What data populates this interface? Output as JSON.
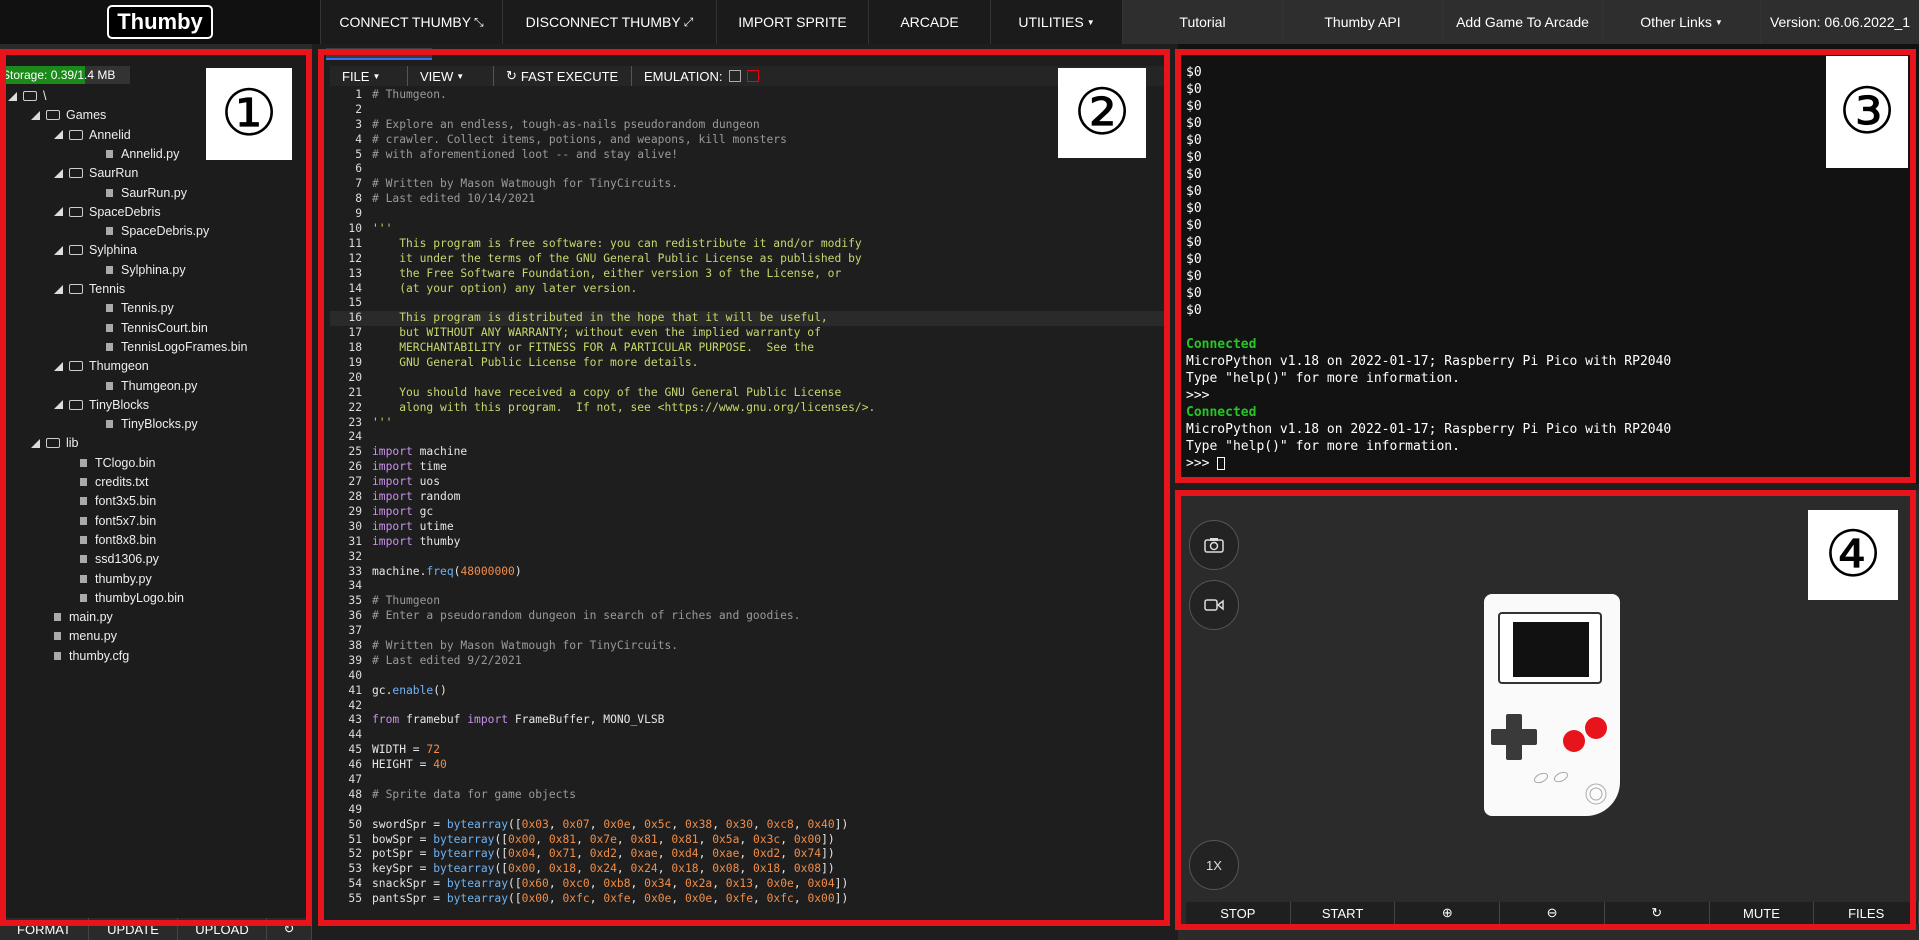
{
  "nav": {
    "logo": "Thumby",
    "buttons": [
      {
        "label": "CONNECT THUMBY",
        "icon": "shrink-arrows-icon"
      },
      {
        "label": "DISCONNECT THUMBY",
        "icon": "expand-arrows-icon"
      },
      {
        "label": "IMPORT SPRITE"
      },
      {
        "label": "ARCADE"
      },
      {
        "label": "UTILITIES"
      },
      {
        "label": "Tutorial"
      },
      {
        "label": "Thumby API"
      },
      {
        "label": "Add Game To Arcade"
      },
      {
        "label": "Other Links"
      },
      {
        "label": "Version: 06.06.2022_1"
      }
    ]
  },
  "filesystem": {
    "storage": "Storage: 0.39/1.4 MB",
    "tree": [
      {
        "label": "\\",
        "type": "folder",
        "depth": 0
      },
      {
        "label": "Games",
        "type": "folder",
        "depth": 1
      },
      {
        "label": "Annelid",
        "type": "folder",
        "depth": 2
      },
      {
        "label": "Annelid.py",
        "type": "file",
        "depth": 3
      },
      {
        "label": "SaurRun",
        "type": "folder",
        "depth": 2
      },
      {
        "label": "SaurRun.py",
        "type": "file",
        "depth": 3
      },
      {
        "label": "SpaceDebris",
        "type": "folder",
        "depth": 2
      },
      {
        "label": "SpaceDebris.py",
        "type": "file",
        "depth": 3
      },
      {
        "label": "Sylphina",
        "type": "folder",
        "depth": 2
      },
      {
        "label": "Sylphina.py",
        "type": "file",
        "depth": 3
      },
      {
        "label": "Tennis",
        "type": "folder",
        "depth": 2
      },
      {
        "label": "Tennis.py",
        "type": "file",
        "depth": 3
      },
      {
        "label": "TennisCourt.bin",
        "type": "file",
        "depth": 3
      },
      {
        "label": "TennisLogoFrames.bin",
        "type": "file",
        "depth": 3
      },
      {
        "label": "Thumgeon",
        "type": "folder",
        "depth": 2
      },
      {
        "label": "Thumgeon.py",
        "type": "file",
        "depth": 3
      },
      {
        "label": "TinyBlocks",
        "type": "folder",
        "depth": 2
      },
      {
        "label": "TinyBlocks.py",
        "type": "file",
        "depth": 3
      },
      {
        "label": "lib",
        "type": "folder",
        "depth": 1
      },
      {
        "label": "TClogo.bin",
        "type": "file",
        "depth": 2
      },
      {
        "label": "credits.txt",
        "type": "file",
        "depth": 2
      },
      {
        "label": "font3x5.bin",
        "type": "file",
        "depth": 2
      },
      {
        "label": "font5x7.bin",
        "type": "file",
        "depth": 2
      },
      {
        "label": "font8x8.bin",
        "type": "file",
        "depth": 2
      },
      {
        "label": "ssd1306.py",
        "type": "file",
        "depth": 2
      },
      {
        "label": "thumby.py",
        "type": "file",
        "depth": 2
      },
      {
        "label": "thumbyLogo.bin",
        "type": "file",
        "depth": 2
      },
      {
        "label": "main.py",
        "type": "file",
        "depth": 1
      },
      {
        "label": "menu.py",
        "type": "file",
        "depth": 1
      },
      {
        "label": "thumby.cfg",
        "type": "file",
        "depth": 1
      }
    ],
    "bottom_buttons": [
      "FORMAT",
      "UPDATE",
      "UPLOAD",
      "↻"
    ]
  },
  "editor": {
    "toolbar": {
      "file": "FILE",
      "view": "VIEW",
      "fast_execute": "FAST EXECUTE",
      "emulation": "EMULATION:"
    },
    "highlight_line": 16,
    "lines": [
      [
        [
          "com",
          "# Thumgeon."
        ]
      ],
      [],
      [
        [
          "com",
          "# Explore an endless, tough-as-nails pseudorandom dungeon"
        ]
      ],
      [
        [
          "com",
          "# crawler. Collect items, potions, and weapons, kill monsters"
        ]
      ],
      [
        [
          "com",
          "# with aforementioned loot -- and stay alive!"
        ]
      ],
      [],
      [
        [
          "com",
          "# Written by Mason Watmough for TinyCircuits."
        ]
      ],
      [
        [
          "com",
          "# Last edited 10/14/2021"
        ]
      ],
      [],
      [
        [
          "str",
          "'''"
        ]
      ],
      [
        [
          "str",
          "    This program is free software: you can redistribute it and/or modify"
        ]
      ],
      [
        [
          "str",
          "    it under the terms of the GNU General Public License as published by"
        ]
      ],
      [
        [
          "str",
          "    the Free Software Foundation, either version 3 of the License, or"
        ]
      ],
      [
        [
          "str",
          "    (at your option) any later version."
        ]
      ],
      [],
      [
        [
          "str",
          "    This program is distributed in the hope that it will be useful,"
        ]
      ],
      [
        [
          "str",
          "    but WITHOUT ANY WARRANTY; without even the implied warranty of"
        ]
      ],
      [
        [
          "str",
          "    MERCHANTABILITY or FITNESS FOR A PARTICULAR PURPOSE.  See the"
        ]
      ],
      [
        [
          "str",
          "    GNU General Public License for more details."
        ]
      ],
      [],
      [
        [
          "str",
          "    You should have received a copy of the GNU General Public License"
        ]
      ],
      [
        [
          "str",
          "    along with this program.  If not, see <https://www.gnu.org/licenses/>."
        ]
      ],
      [
        [
          "str",
          "'''"
        ]
      ],
      [],
      [
        [
          "kw",
          "import"
        ],
        [
          "txt",
          " machine"
        ]
      ],
      [
        [
          "kw",
          "import"
        ],
        [
          "txt",
          " time"
        ]
      ],
      [
        [
          "kw",
          "import"
        ],
        [
          "txt",
          " uos"
        ]
      ],
      [
        [
          "kw",
          "import"
        ],
        [
          "txt",
          " random"
        ]
      ],
      [
        [
          "kw",
          "import"
        ],
        [
          "txt",
          " gc"
        ]
      ],
      [
        [
          "kw",
          "import"
        ],
        [
          "txt",
          " utime"
        ]
      ],
      [
        [
          "kw",
          "import"
        ],
        [
          "txt",
          " thumby"
        ]
      ],
      [],
      [
        [
          "txt",
          "machine."
        ],
        [
          "fn",
          "freq"
        ],
        [
          "txt",
          "("
        ],
        [
          "num",
          "48000000"
        ],
        [
          "txt",
          ")"
        ]
      ],
      [],
      [
        [
          "com",
          "# Thumgeon"
        ]
      ],
      [
        [
          "com",
          "# Enter a pseudorandom dungeon in search of riches and goodies."
        ]
      ],
      [],
      [
        [
          "com",
          "# Written by Mason Watmough for TinyCircuits."
        ]
      ],
      [
        [
          "com",
          "# Last edited 9/2/2021"
        ]
      ],
      [],
      [
        [
          "txt",
          "gc."
        ],
        [
          "fn",
          "enable"
        ],
        [
          "txt",
          "()"
        ]
      ],
      [],
      [
        [
          "kw",
          "from"
        ],
        [
          "txt",
          " framebuf "
        ],
        [
          "kw",
          "import"
        ],
        [
          "txt",
          " FrameBuffer, MONO_VLSB"
        ]
      ],
      [],
      [
        [
          "txt",
          "WIDTH = "
        ],
        [
          "num",
          "72"
        ]
      ],
      [
        [
          "txt",
          "HEIGHT = "
        ],
        [
          "num",
          "40"
        ]
      ],
      [],
      [
        [
          "com",
          "# Sprite data for game objects"
        ]
      ],
      [],
      [
        [
          "txt",
          "swordSpr = "
        ],
        [
          "fn",
          "bytearray"
        ],
        [
          "txt",
          "(["
        ],
        [
          "num",
          "0x03"
        ],
        [
          "txt",
          ", "
        ],
        [
          "num",
          "0x07"
        ],
        [
          "txt",
          ", "
        ],
        [
          "num",
          "0x0e"
        ],
        [
          "txt",
          ", "
        ],
        [
          "num",
          "0x5c"
        ],
        [
          "txt",
          ", "
        ],
        [
          "num",
          "0x38"
        ],
        [
          "txt",
          ", "
        ],
        [
          "num",
          "0x30"
        ],
        [
          "txt",
          ", "
        ],
        [
          "num",
          "0xc8"
        ],
        [
          "txt",
          ", "
        ],
        [
          "num",
          "0x40"
        ],
        [
          "txt",
          "])"
        ]
      ],
      [
        [
          "txt",
          "bowSpr = "
        ],
        [
          "fn",
          "bytearray"
        ],
        [
          "txt",
          "(["
        ],
        [
          "num",
          "0x00"
        ],
        [
          "txt",
          ", "
        ],
        [
          "num",
          "0x81"
        ],
        [
          "txt",
          ", "
        ],
        [
          "num",
          "0x7e"
        ],
        [
          "txt",
          ", "
        ],
        [
          "num",
          "0x81"
        ],
        [
          "txt",
          ", "
        ],
        [
          "num",
          "0x81"
        ],
        [
          "txt",
          ", "
        ],
        [
          "num",
          "0x5a"
        ],
        [
          "txt",
          ", "
        ],
        [
          "num",
          "0x3c"
        ],
        [
          "txt",
          ", "
        ],
        [
          "num",
          "0x00"
        ],
        [
          "txt",
          "])"
        ]
      ],
      [
        [
          "txt",
          "potSpr = "
        ],
        [
          "fn",
          "bytearray"
        ],
        [
          "txt",
          "(["
        ],
        [
          "num",
          "0x04"
        ],
        [
          "txt",
          ", "
        ],
        [
          "num",
          "0x71"
        ],
        [
          "txt",
          ", "
        ],
        [
          "num",
          "0xd2"
        ],
        [
          "txt",
          ", "
        ],
        [
          "num",
          "0xae"
        ],
        [
          "txt",
          ", "
        ],
        [
          "num",
          "0xd4"
        ],
        [
          "txt",
          ", "
        ],
        [
          "num",
          "0xae"
        ],
        [
          "txt",
          ", "
        ],
        [
          "num",
          "0xd2"
        ],
        [
          "txt",
          ", "
        ],
        [
          "num",
          "0x74"
        ],
        [
          "txt",
          "])"
        ]
      ],
      [
        [
          "txt",
          "keySpr = "
        ],
        [
          "fn",
          "bytearray"
        ],
        [
          "txt",
          "(["
        ],
        [
          "num",
          "0x00"
        ],
        [
          "txt",
          ", "
        ],
        [
          "num",
          "0x18"
        ],
        [
          "txt",
          ", "
        ],
        [
          "num",
          "0x24"
        ],
        [
          "txt",
          ", "
        ],
        [
          "num",
          "0x24"
        ],
        [
          "txt",
          ", "
        ],
        [
          "num",
          "0x18"
        ],
        [
          "txt",
          ", "
        ],
        [
          "num",
          "0x08"
        ],
        [
          "txt",
          ", "
        ],
        [
          "num",
          "0x18"
        ],
        [
          "txt",
          ", "
        ],
        [
          "num",
          "0x08"
        ],
        [
          "txt",
          "])"
        ]
      ],
      [
        [
          "txt",
          "snackSpr = "
        ],
        [
          "fn",
          "bytearray"
        ],
        [
          "txt",
          "(["
        ],
        [
          "num",
          "0x60"
        ],
        [
          "txt",
          ", "
        ],
        [
          "num",
          "0xc0"
        ],
        [
          "txt",
          ", "
        ],
        [
          "num",
          "0xb8"
        ],
        [
          "txt",
          ", "
        ],
        [
          "num",
          "0x34"
        ],
        [
          "txt",
          ", "
        ],
        [
          "num",
          "0x2a"
        ],
        [
          "txt",
          ", "
        ],
        [
          "num",
          "0x13"
        ],
        [
          "txt",
          ", "
        ],
        [
          "num",
          "0x0e"
        ],
        [
          "txt",
          ", "
        ],
        [
          "num",
          "0x04"
        ],
        [
          "txt",
          "])"
        ]
      ],
      [
        [
          "txt",
          "pantsSpr = "
        ],
        [
          "fn",
          "bytearray"
        ],
        [
          "txt",
          "(["
        ],
        [
          "num",
          "0x00"
        ],
        [
          "txt",
          ", "
        ],
        [
          "num",
          "0xfc"
        ],
        [
          "txt",
          ", "
        ],
        [
          "num",
          "0xfe"
        ],
        [
          "txt",
          ", "
        ],
        [
          "num",
          "0x0e"
        ],
        [
          "txt",
          ", "
        ],
        [
          "num",
          "0x0e"
        ],
        [
          "txt",
          ", "
        ],
        [
          "num",
          "0xfe"
        ],
        [
          "txt",
          ", "
        ],
        [
          "num",
          "0xfc"
        ],
        [
          "txt",
          ", "
        ],
        [
          "num",
          "0x00"
        ],
        [
          "txt",
          "])"
        ]
      ]
    ]
  },
  "shell": {
    "lines": [
      {
        "t": "$0"
      },
      {
        "t": "$0"
      },
      {
        "t": "$0"
      },
      {
        "t": "$0"
      },
      {
        "t": "$0"
      },
      {
        "t": "$0"
      },
      {
        "t": "$0"
      },
      {
        "t": "$0"
      },
      {
        "t": "$0"
      },
      {
        "t": "$0"
      },
      {
        "t": "$0"
      },
      {
        "t": "$0"
      },
      {
        "t": "$0"
      },
      {
        "t": "$0"
      },
      {
        "t": "$0"
      },
      {
        "t": ""
      },
      {
        "t": "Connected",
        "green": true
      },
      {
        "t": "MicroPython v1.18 on 2022-01-17; Raspberry Pi Pico with RP2040"
      },
      {
        "t": "Type \"help()\" for more information."
      },
      {
        "t": ">>>"
      },
      {
        "t": "Connected",
        "green": true
      },
      {
        "t": "MicroPython v1.18 on 2022-01-17; Raspberry Pi Pico with RP2040"
      },
      {
        "t": "Type \"help()\" for more information."
      },
      {
        "t": ">>> ",
        "cursor": true
      }
    ]
  },
  "emulator": {
    "zoom": "1X",
    "bottom_buttons": [
      "STOP",
      "START",
      "⊕",
      "⊖",
      "↻",
      "MUTE",
      "FILES"
    ]
  },
  "badges": [
    "①",
    "②",
    "③",
    "④"
  ],
  "colors": {
    "frame": "#e8141b",
    "accent_tab": "#3a6df0",
    "connected": "#27c527"
  }
}
